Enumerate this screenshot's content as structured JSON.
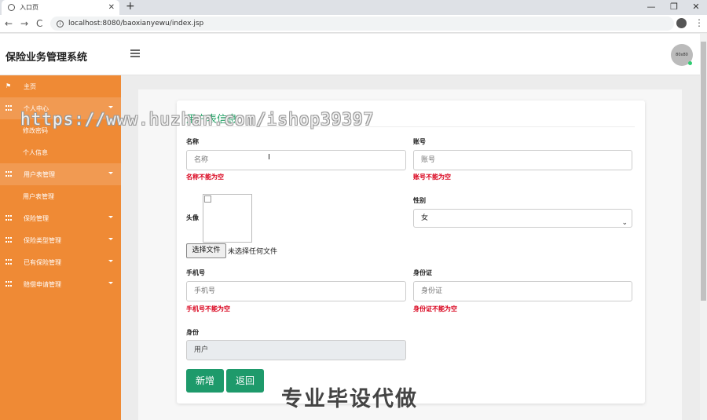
{
  "browser": {
    "tab_title": "入口页",
    "tab_close": "✕",
    "new_tab": "+",
    "url": "localhost:8080/baoxianyewu/index.jsp",
    "back": "←",
    "forward": "→",
    "reload": "C",
    "star": "☆",
    "minimize": "—",
    "restore": "❐",
    "close": "✕",
    "menu": "⋮"
  },
  "header": {
    "brand": "保险业务管理系统",
    "avatar_text": "80x80"
  },
  "sidebar": {
    "items": [
      {
        "label": "主页",
        "icon": "flag-icon"
      },
      {
        "label": "个人中心",
        "icon": "grid-icon"
      },
      {
        "label": "修改密码",
        "icon": ""
      },
      {
        "label": "个人信息",
        "icon": ""
      },
      {
        "label": "用户表管理",
        "icon": "grid-icon"
      },
      {
        "label": "用户表管理",
        "icon": ""
      },
      {
        "label": "保险管理",
        "icon": "grid-icon"
      },
      {
        "label": "保险类型管理",
        "icon": "grid-icon"
      },
      {
        "label": "已有保险管理",
        "icon": "grid-icon"
      },
      {
        "label": "赔偿申请管理",
        "icon": "grid-icon"
      }
    ]
  },
  "form": {
    "title": "用户表信息",
    "name": {
      "label": "名称",
      "placeholder": "名称",
      "error": "名称不能为空"
    },
    "account": {
      "label": "账号",
      "placeholder": "账号",
      "error": "账号不能为空"
    },
    "avatar": {
      "label": "头像",
      "file_button": "选择文件",
      "file_status": "未选择任何文件"
    },
    "gender": {
      "label": "性别",
      "value": "女"
    },
    "phone": {
      "label": "手机号",
      "placeholder": "手机号",
      "error": "手机号不能为空"
    },
    "idcard": {
      "label": "身份证",
      "placeholder": "身份证",
      "error": "身份证不能为空"
    },
    "role": {
      "label": "身份",
      "value": "用户"
    },
    "submit": "新增",
    "back": "返回"
  },
  "watermarks": {
    "url": "https://www.huzhan.com/ishop39397",
    "slogan": "专业毕设代做"
  },
  "colors": {
    "sidebar": "#ef8a35",
    "accent_green": "#1e9a6b",
    "title_green": "#29a36a",
    "error_red": "#d9001b"
  }
}
